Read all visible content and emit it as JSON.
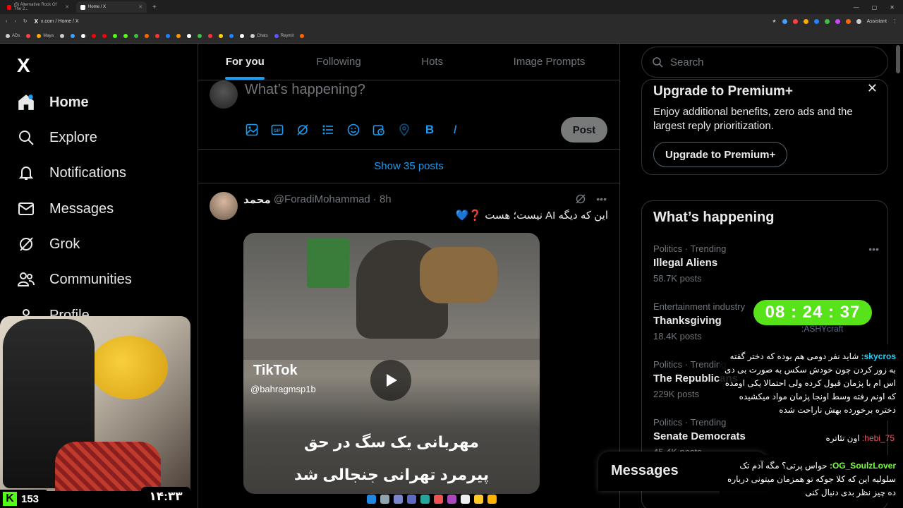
{
  "browser": {
    "tabs": [
      {
        "label": "(6) Alternative Rock Of The 2...",
        "active": false,
        "favicon_color": "#ff0000"
      },
      {
        "label": "Home / X",
        "active": true,
        "favicon_color": "#ffffff"
      }
    ],
    "url": "x.com / Home / X",
    "assistant_label": "Assistant",
    "bookmarks": [
      {
        "label": "ADs",
        "color": "#cccccc"
      },
      {
        "label": "",
        "color": "#ff4040"
      },
      {
        "label": "Maya",
        "color": "#ffaa00"
      },
      {
        "label": "",
        "color": "#cccccc"
      },
      {
        "label": "",
        "color": "#40a0ff"
      },
      {
        "label": "",
        "color": "#ffffff"
      },
      {
        "label": "",
        "color": "#ff0000"
      },
      {
        "label": "",
        "color": "#ff0000"
      },
      {
        "label": "",
        "color": "#53fc18"
      },
      {
        "label": "",
        "color": "#53fc18"
      },
      {
        "label": "",
        "color": "#40c040"
      },
      {
        "label": "",
        "color": "#ff6600"
      },
      {
        "label": "",
        "color": "#ff3333"
      },
      {
        "label": "",
        "color": "#2080ff"
      },
      {
        "label": "",
        "color": "#ff9900"
      },
      {
        "label": "",
        "color": "#ffffff"
      },
      {
        "label": "",
        "color": "#40c040"
      },
      {
        "label": "",
        "color": "#ff3333"
      },
      {
        "label": "",
        "color": "#ffcc00"
      },
      {
        "label": "",
        "color": "#2080ff"
      },
      {
        "label": "",
        "color": "#ffffff"
      },
      {
        "label": "Chats",
        "color": "#cccccc"
      },
      {
        "label": "Reymit",
        "color": "#6050ff"
      },
      {
        "label": "",
        "color": "#ff6600"
      }
    ]
  },
  "nav": {
    "logo": "X",
    "items": [
      {
        "label": "Home",
        "icon": "home-icon"
      },
      {
        "label": "Explore",
        "icon": "search-icon"
      },
      {
        "label": "Notifications",
        "icon": "bell-icon"
      },
      {
        "label": "Messages",
        "icon": "mail-icon"
      },
      {
        "label": "Grok",
        "icon": "grok-icon"
      },
      {
        "label": "Communities",
        "icon": "communities-icon"
      },
      {
        "label": "Profile",
        "icon": "profile-icon"
      }
    ]
  },
  "feed": {
    "tabs": [
      "For you",
      "Following",
      "Hots",
      "Image Prompts"
    ],
    "active_tab": "For you",
    "composer_placeholder": "What’s happening?",
    "post_label": "Post",
    "show_posts": "Show 35 posts"
  },
  "tweet": {
    "name": "محمد",
    "handle": "@ForadiMohammad",
    "time": "· 8h",
    "text": "این که دیگه AI نیست؛ هست ❓💙",
    "media_logo": "TikTok",
    "media_handle": "@bahragmsp1b",
    "caption_line1": "مهربانی یک سگ در حق",
    "caption_line2": "پیرمرد تهرانی جنجالی شد"
  },
  "sidebar": {
    "search_placeholder": "Search",
    "premium": {
      "title": "Upgrade to Premium+",
      "body": "Enjoy additional benefits, zero ads and the largest reply prioritization.",
      "button": "Upgrade to Premium+"
    },
    "happening_title": "What’s happening",
    "trends": [
      {
        "meta": "Politics · Trending",
        "title": "Illegal Aliens",
        "count": "58.7K posts"
      },
      {
        "meta": "Entertainment industry",
        "title": "Thanksgiving",
        "count": "18.4K posts"
      },
      {
        "meta": "Politics · Trending",
        "title": "The Republicans",
        "count": "229K posts"
      },
      {
        "meta": "Politics · Trending",
        "title": "Senate Democrats",
        "count": "45.4K posts"
      }
    ]
  },
  "messages_drawer": "Messages",
  "overlay": {
    "kick_count": "153",
    "clock": "۱۴:۳۳",
    "timer": "08 : 24 : 37",
    "chat_top_user": ":ASHYcraft",
    "chat": [
      {
        "user": "skycros:",
        "text": "شاید نفر دومی هم بوده که دختر گفته به زور کردن چون خودش سکس به صورت بی دی اس ام با پژمان قبول کرده ولی احتمالا یکی اومده که اونم رفته وسط اونجا پژمان مواد میکشیده دختره برخورده بهش ناراحت شده"
      },
      {
        "user": "hebi_75:",
        "text": "اون تئاتره"
      },
      {
        "user": "OG_SoulzLover:",
        "text": "حواس پرتی؟ مگه آدم تک سلولیه این که کلا جوکه تو همزمان میتونی درباره ده چیز نظر بدی دنبال کنی"
      }
    ]
  }
}
